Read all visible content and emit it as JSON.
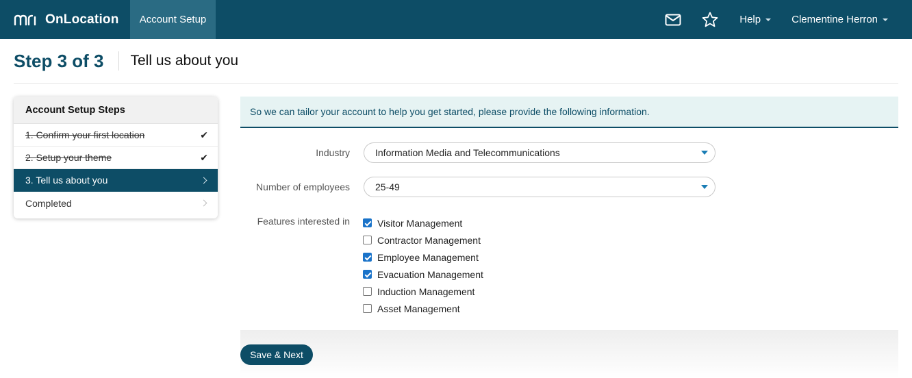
{
  "navbar": {
    "brand_logo_icon": "mri-logo-icon",
    "brand_name": "OnLocation",
    "active_tab": "Account Setup",
    "mail_icon": "mail-icon",
    "star_icon": "star-icon",
    "help_label": "Help",
    "user_name": "Clementine Herron"
  },
  "header": {
    "step": "Step 3 of 3",
    "subtitle": "Tell us about you"
  },
  "sidebar": {
    "title": "Account Setup Steps",
    "items": [
      {
        "label": "1. Confirm your first location",
        "state": "done"
      },
      {
        "label": "2. Setup your theme",
        "state": "done"
      },
      {
        "label": "3. Tell us about you",
        "state": "active"
      },
      {
        "label": "Completed",
        "state": "pending"
      }
    ],
    "check_glyph": "✔"
  },
  "main": {
    "info": "So we can tailor your account to help you get started, please provide the following information.",
    "industry_label": "Industry",
    "industry_value": "Information Media and Telecommunications",
    "employees_label": "Number of employees",
    "employees_value": "25-49",
    "features_label": "Features interested in",
    "features": [
      {
        "label": "Visitor Management",
        "checked": true
      },
      {
        "label": "Contractor Management",
        "checked": false
      },
      {
        "label": "Employee Management",
        "checked": true
      },
      {
        "label": "Evacuation Management",
        "checked": true
      },
      {
        "label": "Induction Management",
        "checked": false
      },
      {
        "label": "Asset Management",
        "checked": false
      }
    ],
    "save_label": "Save & Next"
  },
  "colors": {
    "brand": "#0d4d66",
    "checkbox": "#1a73c9"
  }
}
